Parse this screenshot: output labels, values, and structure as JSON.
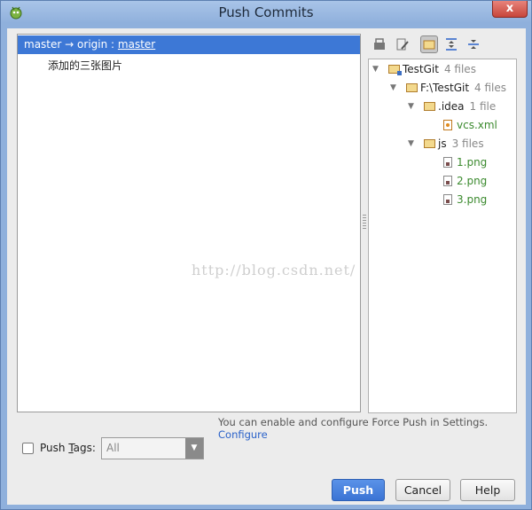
{
  "window": {
    "title": "Push Commits",
    "close_label": "x"
  },
  "commits": {
    "branch": {
      "source": "master",
      "arrow": "→",
      "remote": "origin",
      "separator": ":",
      "target": "master"
    },
    "items": [
      {
        "message": "添加的三张图片"
      }
    ],
    "watermark": "http://blog.csdn.net/"
  },
  "toolbar": {
    "buttons": [
      {
        "icon": "show-diff-icon",
        "active": false
      },
      {
        "icon": "edit-source-icon",
        "active": false
      },
      {
        "icon": "group-by-directory-icon",
        "active": true
      },
      {
        "icon": "expand-all-icon",
        "active": false
      },
      {
        "icon": "collapse-all-icon",
        "active": false
      }
    ]
  },
  "tree": {
    "root": {
      "name": "TestGit",
      "count": "4 files"
    },
    "dir": {
      "name": "F:\\TestGit",
      "count": "4 files"
    },
    "idea": {
      "name": ".idea",
      "count": "1 file"
    },
    "vcs": {
      "name": "vcs.xml"
    },
    "js": {
      "name": "js",
      "count": "3 files"
    },
    "files": [
      "1.png",
      "2.png",
      "3.png"
    ]
  },
  "footnote": {
    "text": "You can enable and configure Force Push in Settings.",
    "link": "Configure"
  },
  "push_tags": {
    "label_prefix": "Push ",
    "label_mnemonic": "T",
    "label_suffix": "ags:",
    "checked": false,
    "select_value": "All"
  },
  "buttons": {
    "push": "Push",
    "cancel": "Cancel",
    "help": "Help"
  },
  "colors": {
    "selection": "#3d78d6",
    "primary_button": "#3b74d4",
    "added_file": "#3b8a2e",
    "link": "#2a62c9"
  }
}
